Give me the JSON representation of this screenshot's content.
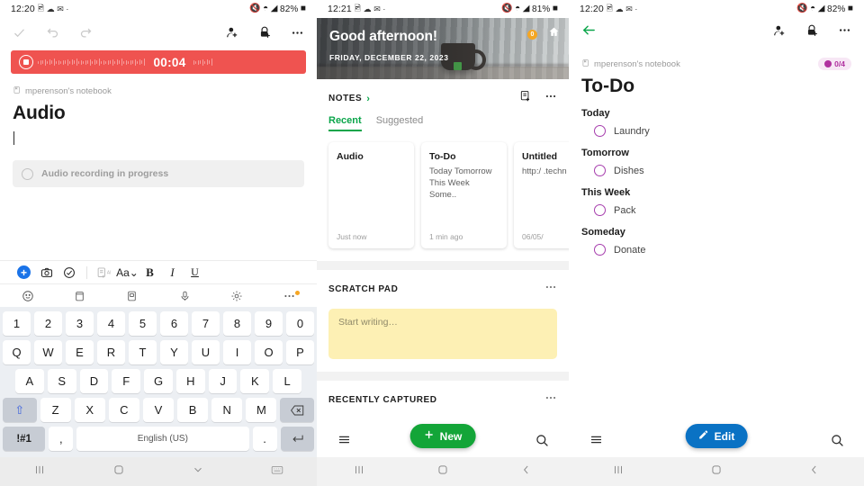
{
  "panel_audio": {
    "status_bar": {
      "time": "12:20",
      "battery": "82%",
      "left_icons": [
        "screenshot-icon",
        "cloud-icon",
        "messages-icon",
        "dot-icon"
      ],
      "right_icons": [
        "mute-icon",
        "wifi-icon",
        "signal-icon",
        "battery-icon"
      ]
    },
    "toolbar": {
      "check": "check-icon",
      "undo": "undo-icon",
      "redo": "redo-icon",
      "share": "share-person-icon",
      "lock": "lock-add-icon",
      "more": "more-icon"
    },
    "recording": {
      "time": "00:04",
      "stop_label": "stop-recording"
    },
    "notebook": "mperenson's notebook",
    "title": "Audio",
    "audio_chip": "Audio recording in progress",
    "format_row1": [
      "add",
      "camera",
      "checkbox",
      "ai-note",
      "Aa",
      "B",
      "I",
      "U"
    ],
    "format_row2": [
      "emoji",
      "clipboard",
      "sticker",
      "microphone",
      "settings",
      "more"
    ],
    "keyboard": {
      "row_num": [
        "1",
        "2",
        "3",
        "4",
        "5",
        "6",
        "7",
        "8",
        "9",
        "0"
      ],
      "row_q": [
        "Q",
        "W",
        "E",
        "R",
        "T",
        "Y",
        "U",
        "I",
        "O",
        "P"
      ],
      "row_a": [
        "A",
        "S",
        "D",
        "F",
        "G",
        "H",
        "J",
        "K",
        "L"
      ],
      "row_z": [
        "Z",
        "X",
        "C",
        "V",
        "B",
        "N",
        "M"
      ],
      "shift": "shift-icon",
      "backspace": "backspace-icon",
      "symbols": "!#1",
      "comma": ",",
      "space": "English (US)",
      "period": ".",
      "enter": "enter-icon"
    },
    "nav": [
      "recents-icon",
      "home-icon",
      "hide-keyboard-icon",
      "keyboard-switch-icon"
    ]
  },
  "panel_home": {
    "status_bar": {
      "time": "12:21",
      "battery": "81%"
    },
    "hero": {
      "greeting": "Good afternoon!",
      "date": "FRIDAY, DECEMBER 22, 2023",
      "badge": "0",
      "home_icon": "home-widget-icon"
    },
    "notes_section": {
      "title": "NOTES",
      "chevron": "›",
      "new_note_icon": "new-note-icon",
      "more_icon": "more-icon"
    },
    "tabs": [
      {
        "label": "Recent",
        "active": true
      },
      {
        "label": "Suggested",
        "active": false
      }
    ],
    "cards": [
      {
        "title": "Audio",
        "body": "",
        "time": "Just now"
      },
      {
        "title": "To-Do",
        "body": "Today Tomorrow This Week Some..",
        "time": "1 min ago"
      },
      {
        "title": "Untitled",
        "body": "http:/ .techn",
        "time": "06/05/"
      }
    ],
    "scratch_pad": {
      "title": "SCRATCH PAD",
      "placeholder": "Start writing…",
      "more_icon": "more-icon"
    },
    "recently_captured": {
      "title": "RECENTLY CAPTURED",
      "more_icon": "more-icon"
    },
    "fab": {
      "label": "New",
      "icon": "plus-icon"
    },
    "bottom_bar": {
      "menu": "hamburger-menu-icon",
      "search": "search-icon"
    },
    "nav": [
      "recents-icon",
      "home-icon",
      "back-icon"
    ]
  },
  "panel_todo": {
    "status_bar": {
      "time": "12:20",
      "battery": "82%"
    },
    "toolbar": {
      "back": "back-arrow-icon",
      "share": "share-person-icon",
      "lock": "lock-add-icon",
      "more": "more-icon"
    },
    "notebook": "mperenson's notebook",
    "progress_badge": "0/4",
    "title": "To-Do",
    "groups": [
      {
        "heading": "Today",
        "items": [
          {
            "label": "Laundry",
            "checked": false
          }
        ]
      },
      {
        "heading": "Tomorrow",
        "items": [
          {
            "label": "Dishes",
            "checked": false
          }
        ]
      },
      {
        "heading": "This Week",
        "items": [
          {
            "label": "Pack",
            "checked": false
          }
        ]
      },
      {
        "heading": "Someday",
        "items": [
          {
            "label": "Donate",
            "checked": false
          }
        ]
      }
    ],
    "fab": {
      "label": "Edit",
      "icon": "pencil-icon"
    },
    "bottom_bar": {
      "menu": "hamburger-menu-icon",
      "search": "search-icon"
    },
    "nav": [
      "recents-icon",
      "home-icon",
      "back-icon"
    ]
  },
  "colors": {
    "recording_red": "#EF5350",
    "accent_green": "#13a538",
    "accent_blue": "#0a72c4",
    "checkbox_purple": "#a63dad",
    "scratch_yellow": "#fdf0b4"
  }
}
